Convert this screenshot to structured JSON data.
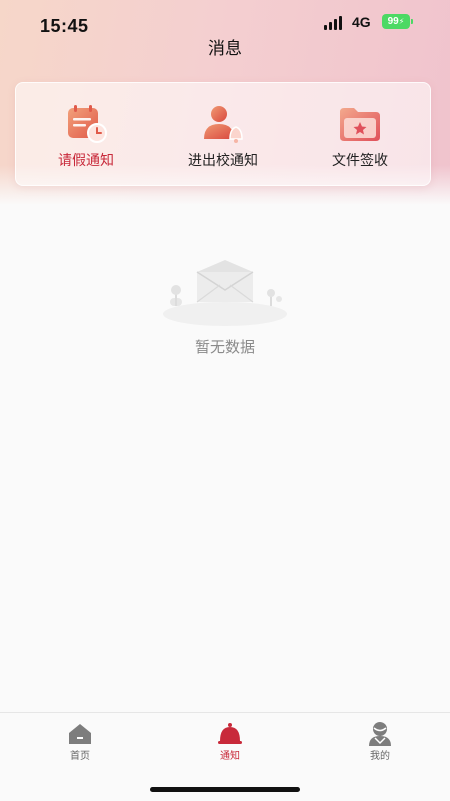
{
  "status": {
    "time": "15:45",
    "network": "4G",
    "battery": "99"
  },
  "header": {
    "title": "消息"
  },
  "quick_actions": [
    {
      "label": "请假通知",
      "icon": "calendar-clock-icon",
      "active": true
    },
    {
      "label": "进出校通知",
      "icon": "person-bell-icon",
      "active": false
    },
    {
      "label": "文件签收",
      "icon": "folder-star-icon",
      "active": false
    }
  ],
  "empty_state": {
    "text": "暂无数据",
    "icon": "empty-envelope-icon"
  },
  "tabbar": {
    "items": [
      {
        "label": "首页",
        "icon": "home-icon"
      },
      {
        "label": "通知",
        "icon": "notification-bell-icon"
      },
      {
        "label": "我的",
        "icon": "user-icon"
      }
    ],
    "active_index": 1
  },
  "colors": {
    "accent": "#c8293a",
    "header_gradient_start": "#f6d7c9",
    "header_gradient_end": "#f0c3cd"
  }
}
